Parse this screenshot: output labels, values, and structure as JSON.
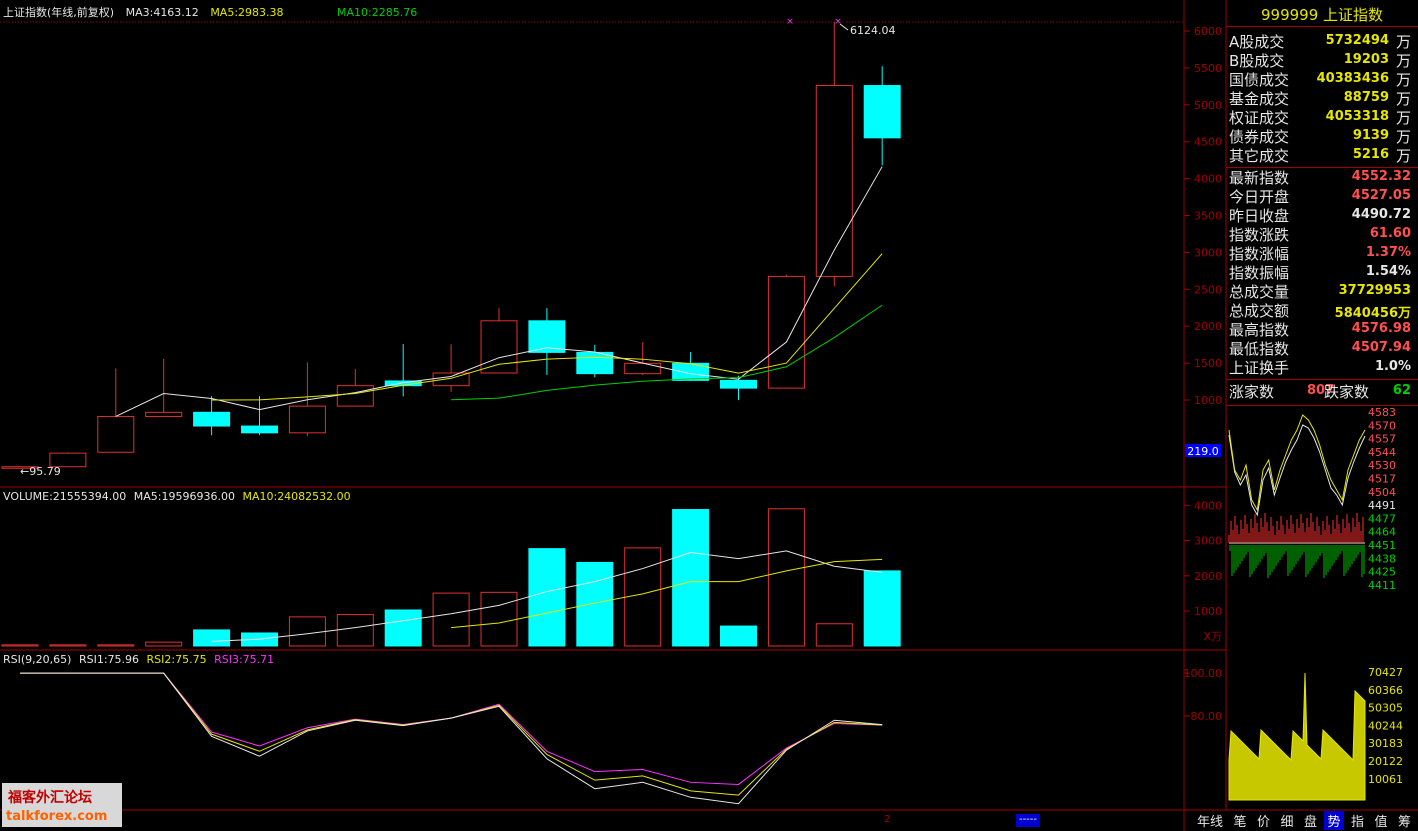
{
  "chart_data": {
    "type": "candlestick",
    "title": "上证指数(年线,前复权)",
    "years_count": 18,
    "candles": [
      {
        "o": 95.79,
        "h": 95.79,
        "l": 95.79,
        "c": 95.79
      },
      {
        "o": 95.79,
        "h": 292,
        "l": 95.79,
        "c": 280
      },
      {
        "o": 292,
        "h": 1429,
        "l": 292,
        "c": 777
      },
      {
        "o": 777,
        "h": 1558,
        "l": 777,
        "c": 833
      },
      {
        "o": 833,
        "h": 1052,
        "l": 522,
        "c": 647
      },
      {
        "o": 647,
        "h": 1052,
        "l": 524,
        "c": 555
      },
      {
        "o": 555,
        "h": 1510,
        "l": 512,
        "c": 917
      },
      {
        "o": 917,
        "h": 1422,
        "l": 917,
        "c": 1194
      },
      {
        "o": 1258,
        "h": 1758,
        "l": 1047,
        "c": 1194
      },
      {
        "o": 1194,
        "h": 1756,
        "l": 1106,
        "c": 1366
      },
      {
        "o": 1366,
        "h": 2245,
        "l": 1361,
        "c": 2073
      },
      {
        "o": 2073,
        "h": 2245,
        "l": 1340,
        "c": 1645
      },
      {
        "o": 1645,
        "h": 1748,
        "l": 1307,
        "c": 1357
      },
      {
        "o": 1357,
        "h": 1783,
        "l": 1339,
        "c": 1497
      },
      {
        "o": 1497,
        "h": 1649,
        "l": 1259,
        "c": 1266
      },
      {
        "o": 1266,
        "h": 1328,
        "l": 998,
        "c": 1161
      },
      {
        "o": 1161,
        "h": 2698,
        "l": 1161,
        "c": 2675
      },
      {
        "o": 2675,
        "h": 6124.04,
        "l": 2541,
        "c": 5261
      },
      {
        "o": 5261,
        "h": 5522,
        "l": 4180,
        "c": 4552.32
      }
    ],
    "ma3": [
      null,
      null,
      777,
      1088,
      1020,
      870,
      1004,
      1100,
      1235,
      1319,
      1573,
      1708,
      1650,
      1500,
      1356,
      1282,
      1786,
      3033,
      4163.12
    ],
    "ma5": [
      null,
      null,
      null,
      null,
      1000,
      1001,
      1043,
      1088,
      1200,
      1294,
      1484,
      1554,
      1580,
      1553,
      1491,
      1364,
      1500,
      2243,
      2983.38
    ],
    "ma10": [
      null,
      null,
      null,
      null,
      null,
      null,
      null,
      null,
      null,
      1003,
      1025,
      1130,
      1202,
      1254,
      1286,
      1303,
      1450,
      1846,
      2285.76
    ],
    "y_ticks": [
      1000,
      1500,
      2000,
      2500,
      3000,
      3500,
      4000,
      4500,
      5000,
      5500,
      6000
    ],
    "ylim": [
      0,
      6400
    ],
    "annotations": {
      "high_label": "6124.04",
      "low_label": "←95.79"
    },
    "legend": [
      {
        "name": "上证指数(年线,前复权)",
        "color": "#e6e6e6"
      },
      {
        "name": "MA3:4163.12",
        "color": "#e6e6e6"
      },
      {
        "name": "MA5:2983.38",
        "color": "#e6e600"
      },
      {
        "name": "MA10:2285.76",
        "color": "#00d000"
      }
    ],
    "volume": {
      "legend": [
        {
          "name": "VOLUME:21555394.00",
          "color": "#e6e6e6"
        },
        {
          "name": "MA5:19596936.00",
          "color": "#e6e6e6"
        },
        {
          "name": "MA10:24082532.00",
          "color": "#e6e600"
        }
      ],
      "values": [
        1.5,
        1.5,
        1.5,
        5,
        21,
        17,
        38,
        41,
        47,
        69,
        70,
        127,
        109,
        128,
        178,
        26,
        179,
        29,
        98
      ],
      "ma5": [
        null,
        null,
        null,
        null,
        6,
        9,
        16,
        24,
        33,
        42,
        53,
        71,
        84,
        101,
        122,
        114,
        124,
        104,
        96
      ],
      "ma10": [
        null,
        null,
        null,
        null,
        null,
        null,
        null,
        null,
        null,
        24,
        30,
        43,
        56,
        68,
        84,
        84,
        98,
        110,
        113
      ],
      "y_ticks": [
        1000,
        2000,
        3000,
        4000
      ],
      "unit_label": "X万",
      "ymax": 180
    },
    "rsi": {
      "legend": [
        {
          "name": "RSI(9,20,65)",
          "color": "#e6e6e6"
        },
        {
          "name": "RSI1:75.96",
          "color": "#e6e6e6"
        },
        {
          "name": "RSI2:75.75",
          "color": "#e6e600"
        },
        {
          "name": "RSI3:75.71",
          "color": "#ff30ff"
        }
      ],
      "rsi1": [
        100,
        100,
        100,
        100,
        70.5,
        61.2,
        73,
        78,
        75.5,
        79,
        84.5,
        60,
        46,
        49,
        42,
        39,
        64,
        78,
        75.96
      ],
      "rsi2": [
        100,
        100,
        100,
        100,
        71.5,
        63.5,
        73.5,
        78.3,
        75.8,
        79,
        85,
        62,
        50,
        52,
        45,
        43,
        64.5,
        77,
        75.75
      ],
      "rsi3": [
        100,
        100,
        100,
        100,
        72.5,
        66,
        74.5,
        78.5,
        76,
        79,
        85.5,
        63.5,
        54,
        55,
        49,
        48,
        65,
        76.5,
        75.71
      ],
      "y_ticks": [
        80.0,
        100.0
      ],
      "ylim": [
        37,
        101
      ]
    }
  },
  "sidebar": {
    "title": "999999 上证指数",
    "rows": [
      {
        "label": "A股成交",
        "value": "5732494",
        "unit": "万",
        "color": "#e6e600"
      },
      {
        "label": "B股成交",
        "value": "19203",
        "unit": "万",
        "color": "#e6e600"
      },
      {
        "label": "国债成交",
        "value": "40383436",
        "unit": "万",
        "color": "#e6e600"
      },
      {
        "label": "基金成交",
        "value": "88759",
        "unit": "万",
        "color": "#e6e600"
      },
      {
        "label": "权证成交",
        "value": "4053318",
        "unit": "万",
        "color": "#e6e600"
      },
      {
        "label": "债券成交",
        "value": "9139",
        "unit": "万",
        "color": "#e6e600"
      },
      {
        "label": "其它成交",
        "value": "5216",
        "unit": "万",
        "color": "#e6e600"
      }
    ],
    "rows2": [
      {
        "label": "最新指数",
        "value": "4552.32",
        "color": "#ff5050"
      },
      {
        "label": "今日开盘",
        "value": "4527.05",
        "color": "#ff5050"
      },
      {
        "label": "昨日收盘",
        "value": "4490.72",
        "color": "#e6e6e6"
      },
      {
        "label": "指数涨跌",
        "value": "61.60",
        "color": "#ff5050"
      },
      {
        "label": "指数涨幅",
        "value": "1.37%",
        "color": "#ff5050"
      },
      {
        "label": "指数振幅",
        "value": "1.54%",
        "color": "#e6e6e6"
      },
      {
        "label": "总成交量",
        "value": "37729953",
        "color": "#e6e600"
      },
      {
        "label": "总成交额",
        "value": "5840456万",
        "color": "#e6e600"
      },
      {
        "label": "最高指数",
        "value": "4576.98",
        "color": "#ff5050"
      },
      {
        "label": "最低指数",
        "value": "4507.94",
        "color": "#ff5050"
      },
      {
        "label": "上证换手",
        "value": "1.0%",
        "color": "#e6e6e6"
      }
    ],
    "breadth": {
      "up_label": "涨家数",
      "up_value": "807",
      "down_label": "跌家数",
      "down_value": "62"
    }
  },
  "mini": {
    "price_ticks": [
      "4583",
      "4570",
      "4557",
      "4544",
      "4530",
      "4517",
      "4504",
      "4491",
      "4477",
      "4464",
      "4451",
      "4438",
      "4425",
      "4411"
    ],
    "vol_ticks": [
      "70427",
      "60366",
      "50305",
      "40244",
      "30183",
      "20122",
      "10061"
    ],
    "cursor_value": "219.0"
  },
  "bottom": {
    "period_tab": "年线",
    "tabs": [
      "笔",
      "价",
      "细",
      "盘",
      "势",
      "指",
      "值",
      "筹"
    ],
    "active_tab": "势",
    "marker": "2",
    "dashes": "-----"
  },
  "logo": {
    "line1": "福客外汇论坛",
    "line2": "talkforex.com"
  }
}
